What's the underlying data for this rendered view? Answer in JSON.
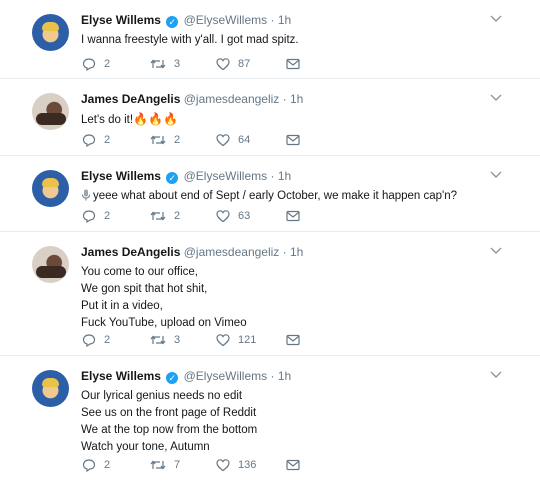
{
  "tweets": [
    {
      "name": "Elyse Willems",
      "handle": "@ElyseWillems",
      "time": "1h",
      "verified": true,
      "avatar": "elyse",
      "lines": [
        "I wanna freestyle with y'all. I got mad spitz."
      ],
      "replies": "2",
      "retweets": "3",
      "likes": "87"
    },
    {
      "name": "James DeAngelis",
      "handle": "@jamesdeangeliz",
      "time": "1h",
      "verified": false,
      "avatar": "james",
      "lines": [
        "Let's do it!"
      ],
      "emoji": "🔥🔥🔥",
      "replies": "2",
      "retweets": "2",
      "likes": "64"
    },
    {
      "name": "Elyse Willems",
      "handle": "@ElyseWillems",
      "time": "1h",
      "verified": true,
      "avatar": "elyse",
      "lines": [
        "yeee what about end of Sept / early October, we make it happen cap'n?"
      ],
      "replies": "2",
      "retweets": "2",
      "likes": "63"
    },
    {
      "name": "James DeAngelis",
      "handle": "@jamesdeangeliz",
      "time": "1h",
      "verified": false,
      "avatar": "james",
      "lines": [
        "You come to our office,",
        "We gon spit that hot shit,",
        "Put it in a video,",
        "Fuck YouTube, upload on Vimeo"
      ],
      "replies": "2",
      "retweets": "3",
      "likes": "121"
    },
    {
      "name": "Elyse Willems",
      "handle": "@ElyseWillems",
      "time": "1h",
      "verified": true,
      "avatar": "elyse",
      "lines": [
        "Our lyrical genius needs no edit",
        "See us on the front page of Reddit",
        "We at the top now from the bottom",
        "Watch your tone, Autumn"
      ],
      "replies": "2",
      "retweets": "7",
      "likes": "136"
    }
  ],
  "separator": "·",
  "colors": {
    "verified": "#1da1f2",
    "muted": "#657786",
    "text": "#14171a",
    "divider": "#e6ecf0"
  },
  "icons": {
    "reply": "reply-icon",
    "retweet": "retweet-icon",
    "like": "heart-icon",
    "dm": "envelope-icon",
    "caret": "chevron-down-icon",
    "verified": "verified-badge-icon"
  }
}
